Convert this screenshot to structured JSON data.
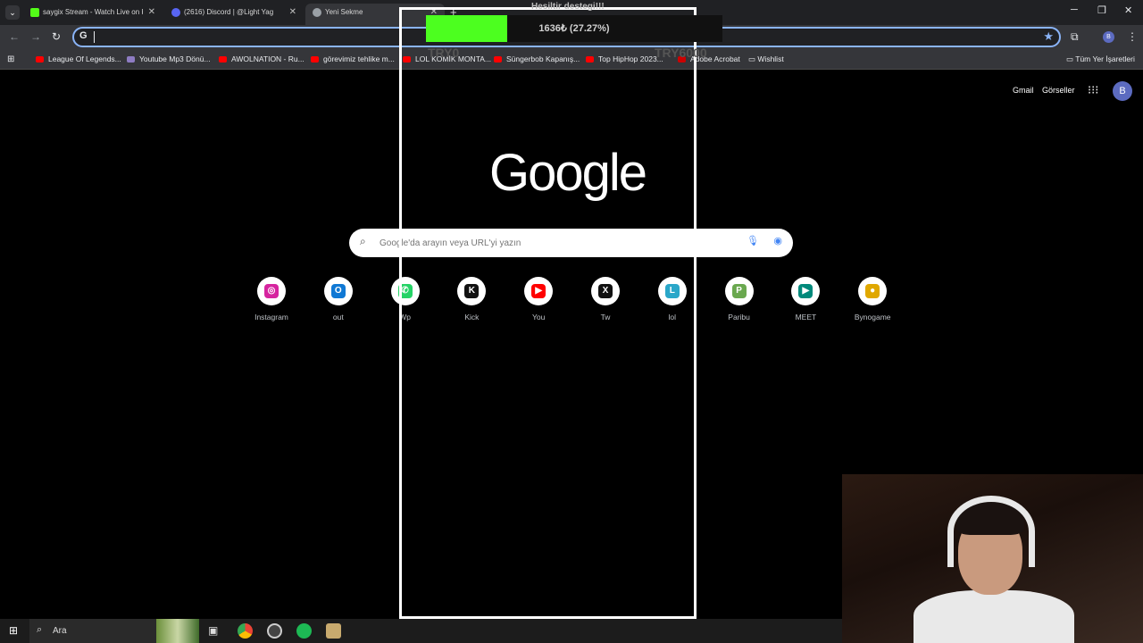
{
  "browser": {
    "tabs": [
      {
        "title": "saygix Stream - Watch Live on Kick",
        "favicon_color": "#53fc18",
        "close": "✕"
      },
      {
        "title": "(2616) Discord | @Light Yag",
        "favicon_color": "#5865f2",
        "close": "✕"
      },
      {
        "title": "Yeni Sekme",
        "favicon_color": "#9aa0a6",
        "close": "✕"
      }
    ],
    "new_tab": "+",
    "omnibox_value": "",
    "bookmarks": [
      {
        "label": "League Of Legends..."
      },
      {
        "label": "Youtube Mp3 Dönü..."
      },
      {
        "label": "AWOLNATION - Ru..."
      },
      {
        "label": "görevimiz tehlike m..."
      },
      {
        "label": "LOL KOMİK MONTA..."
      },
      {
        "label": "Süngerbob Kapanış..."
      },
      {
        "label": "Top HipHop 2023..."
      },
      {
        "label": "Adobe Acrobat"
      },
      {
        "label": "Wishlist"
      }
    ],
    "all_bookmarks": "Tüm Yer İşaretleri",
    "profile_initial": "B"
  },
  "newtab": {
    "gmail": "Gmail",
    "images": "Görseller",
    "avatar": "B",
    "logo": "Google",
    "search_placeholder": "Google'da arayın veya URL'yi yazın",
    "shortcuts": [
      {
        "label": "Instagram",
        "glyph": "◎",
        "color": "#d6249f"
      },
      {
        "label": "out",
        "glyph": "O",
        "color": "#0f78d4"
      },
      {
        "label": "Wp",
        "glyph": "✆",
        "color": "#25d366"
      },
      {
        "label": "Kick",
        "glyph": "K",
        "color": "#111111"
      },
      {
        "label": "You",
        "glyph": "▶",
        "color": "#ff0000"
      },
      {
        "label": "Tw",
        "glyph": "X",
        "color": "#111111"
      },
      {
        "label": "lol",
        "glyph": "L",
        "color": "#2aa7c9"
      },
      {
        "label": "Paribu",
        "glyph": "P",
        "color": "#6aa84f"
      },
      {
        "label": "MEET",
        "glyph": "▶",
        "color": "#00897b"
      },
      {
        "label": "Bynogame",
        "glyph": "●",
        "color": "#e0a800"
      }
    ]
  },
  "donation_goal": {
    "title": "Hesiltir destegi!!!",
    "amount_text": "1636₺ (27.27%)",
    "progress_fraction": 0.2727,
    "min_label": "TRY0",
    "max_label": "TRY6000",
    "fill_color": "#4cff1f"
  },
  "taskbar": {
    "search_label": "Ara"
  }
}
